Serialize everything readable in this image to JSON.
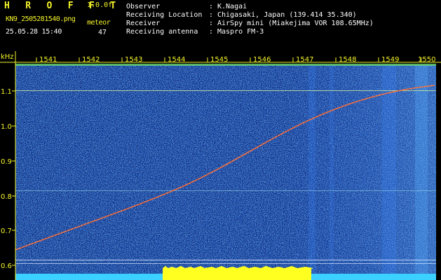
{
  "header": {
    "app_title": "H R O F F T",
    "version": "1.0.0f",
    "file_name": "KN9_2505281540.png",
    "timestamp": "25.05.28 15:40",
    "meteor_label": "meteor",
    "meteor_count": "47",
    "metadata": [
      {
        "label": "Observer",
        "value": "K.Nagai"
      },
      {
        "label": "Receiving Location",
        "value": "Chigasaki, Japan (139.414 35.340)"
      },
      {
        "label": "Receiver",
        "value": "AirSpy mini (Miakejima VOR 108.65MHz)"
      },
      {
        "label": "Receiving antenna",
        "value": "Maspro FM-3"
      }
    ],
    "separator": ":"
  },
  "spectrogram": {
    "y_unit": "kHz",
    "y_ticks": [
      "1.1",
      "1.0",
      "0.9",
      "0.8",
      "0.7",
      "0.6"
    ],
    "x_ticks": [
      "1541",
      "1542",
      "1543",
      "1544",
      "1545",
      "1546",
      "1547",
      "1548",
      "1549",
      "1550"
    ],
    "colors": {
      "background": "#000000",
      "noise_dark": "#0a1e6e",
      "noise_mid": "#1e50dc",
      "noise_light": "#64c8ff",
      "trace": "#ff6030",
      "axis_text": "#f5f52a",
      "band_cyan": "#3ad0ff",
      "band_yellow": "#ffff20"
    }
  }
}
